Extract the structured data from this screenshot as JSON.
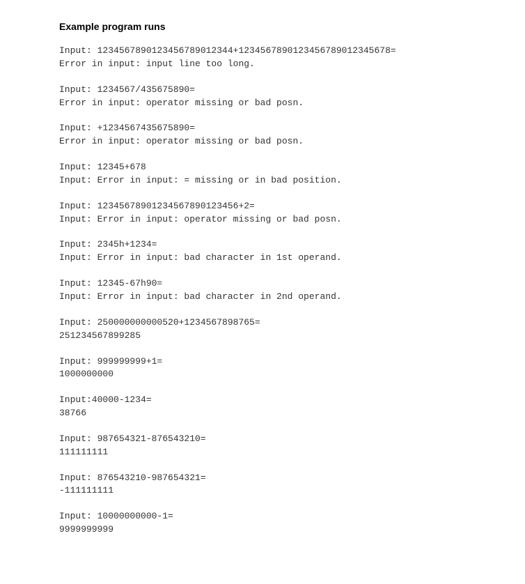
{
  "heading": "Example program runs",
  "runs": [
    {
      "line1": "Input: 1234567890123456789012344+123456789012345678901234567​8=",
      "line2": "Error in input: input line too long."
    },
    {
      "line1": "Input: 1234567/435675890=",
      "line2": "Error in input: operator missing or bad posn."
    },
    {
      "line1": "Input: +1234567435675890=",
      "line2": "Error in input: operator missing or bad posn."
    },
    {
      "line1": "Input: 12345+678",
      "line2": "Input: Error in input: = missing or in bad position."
    },
    {
      "line1": "Input: 12345678901234567890123456+2=",
      "line2": "Input: Error in input: operator missing or bad posn."
    },
    {
      "line1": "Input: 2345h+1234=",
      "line2": "Input: Error in input: bad character in 1st operand."
    },
    {
      "line1": "Input: 12345-67h90=",
      "line2": "Input: Error in input: bad character in 2nd operand."
    },
    {
      "line1": "Input: 250000000000520+1234567898765=",
      "line2": "251234567899285"
    },
    {
      "line1": "Input: 999999999+1=",
      "line2": "1000000000"
    },
    {
      "line1": "Input:40000-1234=",
      "line2": "38766"
    },
    {
      "line1": "Input: 987654321-876543210=",
      "line2": "111111111"
    },
    {
      "line1": "Input: 876543210-987654321=",
      "line2": "-111111111"
    },
    {
      "line1": "Input: 10000000000-1=",
      "line2": "9999999999"
    }
  ]
}
